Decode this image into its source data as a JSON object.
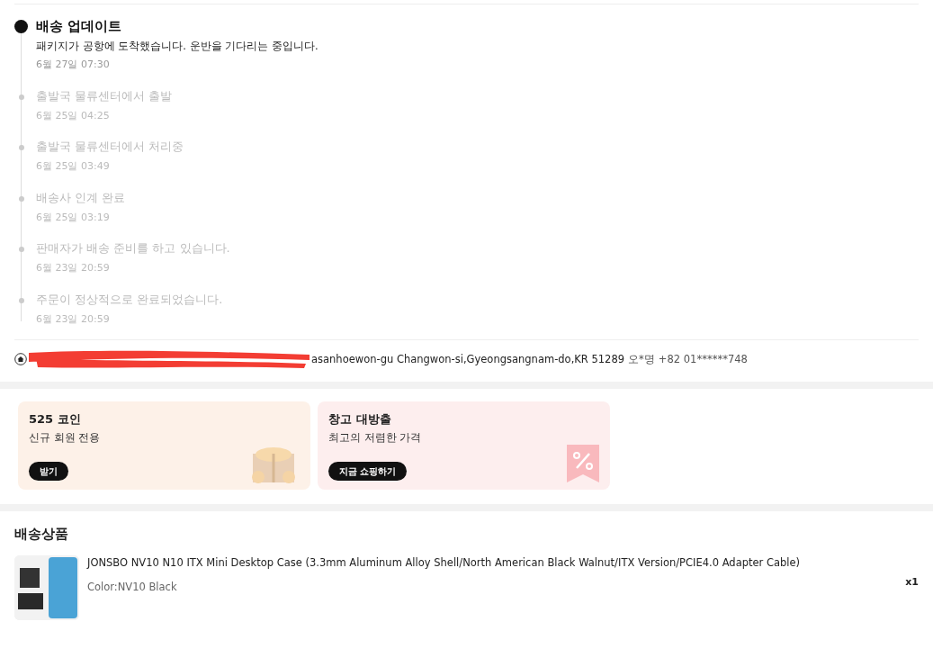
{
  "tracking": {
    "events": [
      {
        "title": "배송 업데이트",
        "description": "패키지가 공항에 도착했습니다. 운반을 기다리는 중입니다.",
        "time": "6월 27일 07:30",
        "current": true
      },
      {
        "title": "출발국 물류센터에서 출발",
        "time": "6월 25일 04:25",
        "current": false
      },
      {
        "title": "출발국 물류센터에서 처리중",
        "time": "6월 25일 03:49",
        "current": false
      },
      {
        "title": "배송사 인계 완료",
        "time": "6월 25일 03:19",
        "current": false
      },
      {
        "title": "판매자가 배송 준비를 하고 있습니다.",
        "time": "6월 23일 20:59",
        "current": false
      },
      {
        "title": "주문이 정상적으로 완료되었습니다.",
        "time": "6월 23일 20:59",
        "current": false
      }
    ]
  },
  "address": {
    "text": "asanhoewon-gu Changwon-si,Gyeongsangnam-do,KR 51289",
    "recipient": "오*명",
    "phone": "+82 01******748"
  },
  "promos": [
    {
      "kind": "coins",
      "title": "525 코인",
      "subtitle": "신규 회원 전용",
      "button": "받기"
    },
    {
      "kind": "sale",
      "title": "창고 대방출",
      "subtitle": "최고의 저렴한 가격",
      "button": "지금 쇼핑하기"
    }
  ],
  "shipment": {
    "heading": "배송상품",
    "items": [
      {
        "title": "JONSBO NV10 N10 ITX Mini Desktop Case (3.3mm Aluminum Alloy Shell/North American Black Walnut/ITX Version/PCIE4.0 Adapter Cable)",
        "option": "Color:NV10 Black",
        "quantity": "x1"
      }
    ]
  }
}
